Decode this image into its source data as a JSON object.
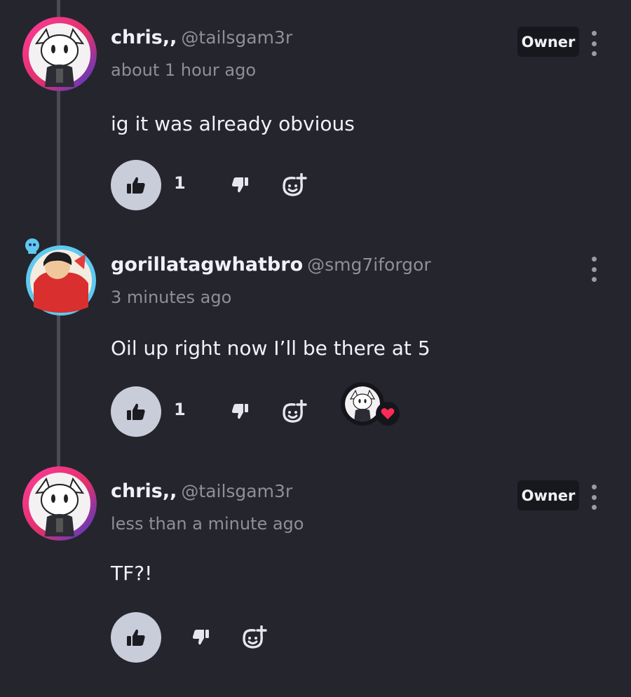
{
  "comments": [
    {
      "name": "chris,,",
      "handle": "@tailsgam3r",
      "time": "about 1 hour ago",
      "text": "ig it was already obvious",
      "badge": "Owner",
      "likes": "1"
    },
    {
      "name": "gorillatagwhatbro",
      "handle": "@smg7iforgor",
      "time": "3 minutes ago",
      "text": "Oil up right now I’ll be there at 5",
      "likes": "1",
      "reaction": "heart-icon"
    },
    {
      "name": "chris,,",
      "handle": "@tailsgam3r",
      "time": "less than a minute ago",
      "text": "TF?!",
      "badge": "Owner"
    }
  ],
  "colors": {
    "background": "#24252d",
    "like_button_bg": "#c9ccd9",
    "heart": "#ff2a55"
  }
}
